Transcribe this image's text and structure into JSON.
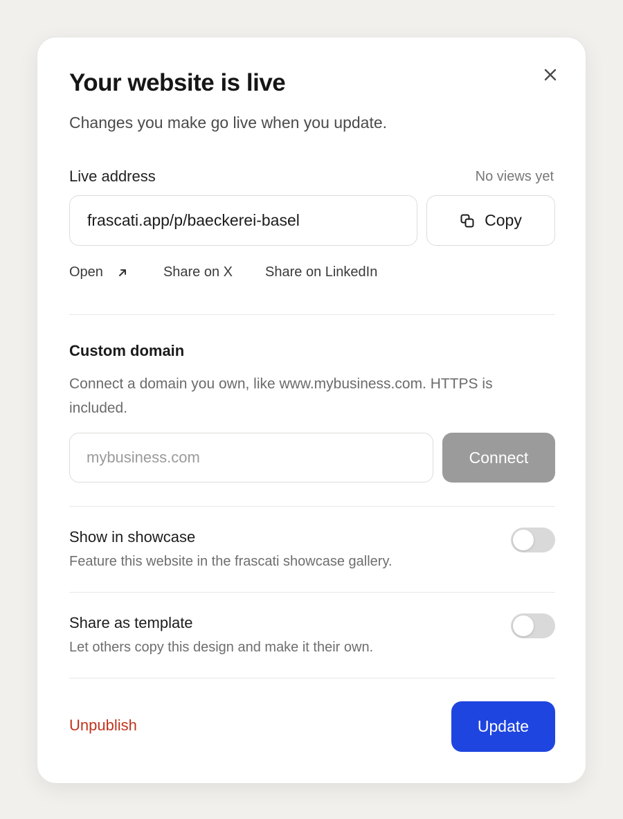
{
  "dialog": {
    "title": "Your website is live",
    "subtitle": "Changes you make go live when you update."
  },
  "live": {
    "label": "Live address",
    "views": "No views yet",
    "url": "frascati.app/p/baeckerei-basel",
    "copy_label": "Copy",
    "links": {
      "open": "Open",
      "share_x": "Share on X",
      "share_linkedin": "Share on LinkedIn"
    }
  },
  "custom_domain": {
    "title": "Custom domain",
    "description": "Connect a domain you own, like www.mybusiness.com. HTTPS is included.",
    "placeholder": "mybusiness.com",
    "value": "",
    "connect_label": "Connect"
  },
  "showcase": {
    "title": "Show in showcase",
    "description": "Feature this website in the frascati showcase gallery.",
    "enabled": false
  },
  "template": {
    "title": "Share as template",
    "description": "Let others copy this design and make it their own.",
    "enabled": false
  },
  "footer": {
    "unpublish_label": "Unpublish",
    "update_label": "Update"
  },
  "colors": {
    "primary": "#1f45e0",
    "danger": "#c0341d",
    "disabled": "#9b9b9b",
    "toggle_off": "#d9d9d9"
  },
  "icons": {
    "close": "close-icon",
    "copy": "copy-icon",
    "open": "arrow-up-right-icon"
  }
}
